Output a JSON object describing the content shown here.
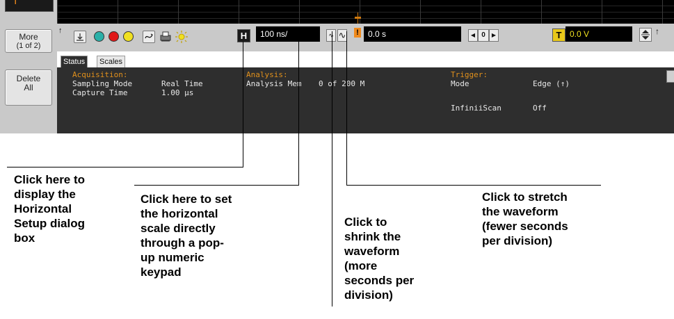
{
  "softkeys": {
    "more_label": "More",
    "more_sub": "(1 of 2)",
    "delete_label": "Delete\nAll"
  },
  "toolbar": {
    "horizontal_button_label": "H",
    "timebase_value": "100 ns/",
    "shrink_glyph": "∿",
    "stretch_glyph": "∿",
    "trigger_ref_glyph": "!",
    "delay_value": "0.0 s",
    "nav_left_glyph": "◀",
    "nav_center_value": "0",
    "nav_right_glyph": "▶",
    "trigger_button_label": "T",
    "trigger_level_value": "0.0 V",
    "pin_glyph": "↑"
  },
  "tabs": {
    "status": "Status",
    "scales": "Scales"
  },
  "status_panel": {
    "acquisition": {
      "header": "Acquisition:",
      "rows": [
        {
          "label": "Sampling Mode",
          "value": "Real Time"
        },
        {
          "label": "Capture Time",
          "value": "1.00 µs"
        }
      ]
    },
    "analysis": {
      "header": "Analysis:",
      "rows": [
        {
          "label": "Analysis Mem",
          "value": "0 of 200 M"
        }
      ]
    },
    "trigger": {
      "header": "Trigger:",
      "rows": [
        {
          "label": "Mode",
          "value": "Edge (↑)"
        },
        {
          "label": "InfiniiScan",
          "value": "Off"
        }
      ]
    }
  },
  "callouts": {
    "horizontal_setup": "Click here to\ndisplay the\nHorizontal\nSetup dialog\nbox",
    "keypad": "Click here to set\nthe horizontal\nscale directly\nthrough a pop-\nup numeric\nkeypad",
    "shrink": "Click to\nshrink the\nwaveform\n(more\nseconds per\ndivision)",
    "stretch": "Click to stretch\nthe waveform\n(fewer seconds\nper division)"
  },
  "colors": {
    "accent_orange": "#e0901c",
    "cyan": "#2ab0a8",
    "red": "#e01818",
    "yellow": "#f0e020",
    "panel_bg": "#2e2e2e",
    "toolbar_bg": "#c9c9c9"
  }
}
